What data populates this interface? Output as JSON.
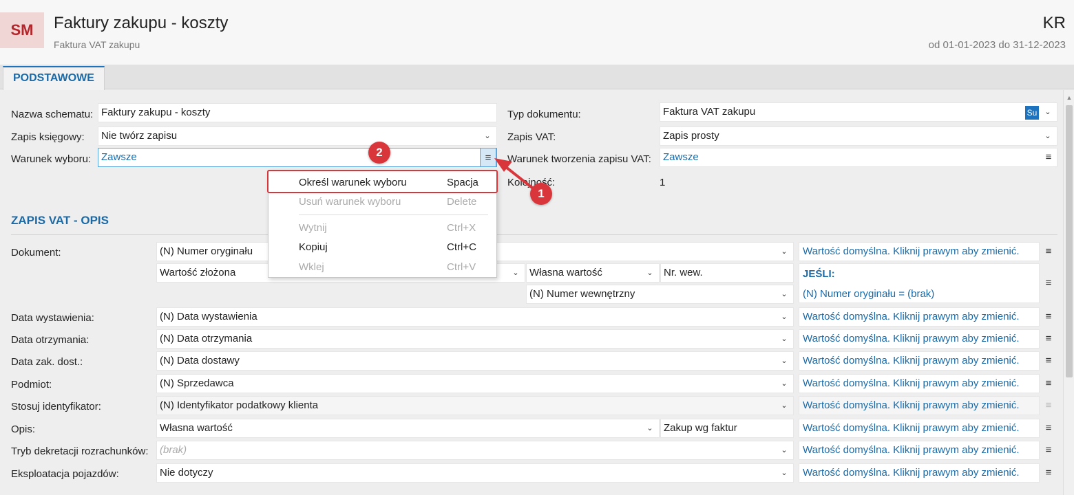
{
  "header": {
    "logo": "SM",
    "title": "Faktury zakupu - koszty",
    "subtitle": "Faktura VAT zakupu",
    "user_code": "KR",
    "period": "od 01-01-2023 do 31-12-2023"
  },
  "tabs": [
    {
      "label": "PODSTAWOWE",
      "active": true
    }
  ],
  "form": {
    "nazwa_label": "Nazwa schematu:",
    "nazwa_value": "Faktury zakupu - koszty",
    "zapis_ks_label": "Zapis księgowy:",
    "zapis_ks_value": "Nie twórz zapisu",
    "warunek_label": "Warunek wyboru:",
    "warunek_value": "Zawsze",
    "typ_dok_label": "Typ dokumentu:",
    "typ_dok_value": "Faktura VAT zakupu",
    "typ_dok_badge": "Su",
    "zapis_vat_label": "Zapis VAT:",
    "zapis_vat_value": "Zapis prosty",
    "warunek_vat_label": "Warunek tworzenia zapisu VAT:",
    "warunek_vat_value": "Zawsze",
    "kolejnosc_label": "Kolejność:",
    "kolejnosc_value": "1"
  },
  "section": {
    "title": "ZAPIS VAT - OPIS"
  },
  "rows": {
    "dokument": {
      "label": "Dokument:",
      "value": "(N) Numer oryginału",
      "rhs": "Wartość domyślna. Kliknij prawym aby zmienić."
    },
    "dokument_sub": {
      "value": "Wartość złożona",
      "own": "Własna wartość",
      "text": "Nr. wew.",
      "field": "(N) Numer wewnętrzny",
      "if_title": "JEŚLI:",
      "if_cond": "(N) Numer oryginału = (brak)"
    },
    "data_wyst": {
      "label": "Data wystawienia:",
      "value": "(N) Data wystawienia",
      "rhs": "Wartość domyślna. Kliknij prawym aby zmienić."
    },
    "data_otrz": {
      "label": "Data otrzymania:",
      "value": "(N) Data otrzymania",
      "rhs": "Wartość domyślna. Kliknij prawym aby zmienić."
    },
    "data_zak": {
      "label": "Data zak. dost.:",
      "value": "(N) Data dostawy",
      "rhs": "Wartość domyślna. Kliknij prawym aby zmienić."
    },
    "podmiot": {
      "label": "Podmiot:",
      "value": "(N) Sprzedawca",
      "rhs": "Wartość domyślna. Kliknij prawym aby zmienić."
    },
    "stosuj": {
      "label": "Stosuj identyfikator:",
      "value": "(N) Identyfikator podatkowy klienta",
      "rhs": "Wartość domyślna. Kliknij prawym aby zmienić."
    },
    "opis": {
      "label": "Opis:",
      "value": "Własna wartość",
      "text": "Zakup wg faktur",
      "rhs": "Wartość domyślna. Kliknij prawym aby zmienić."
    },
    "tryb": {
      "label": "Tryb dekretacji rozrachunków:",
      "placeholder": "(brak)",
      "rhs": "Wartość domyślna. Kliknij prawym aby zmienić."
    },
    "eksploatacja": {
      "label": "Eksploatacja pojazdów:",
      "value": "Nie dotyczy",
      "rhs": "Wartość domyślna. Kliknij prawym aby zmienić."
    }
  },
  "context_menu": {
    "items": [
      {
        "label": "Określ warunek wyboru",
        "shortcut": "Spacja",
        "enabled": true
      },
      {
        "label": "Usuń warunek wyboru",
        "shortcut": "Delete",
        "enabled": false
      },
      {
        "label": "Wytnij",
        "shortcut": "Ctrl+X",
        "enabled": false
      },
      {
        "label": "Kopiuj",
        "shortcut": "Ctrl+C",
        "enabled": true
      },
      {
        "label": "Wklej",
        "shortcut": "Ctrl+V",
        "enabled": false
      }
    ]
  },
  "annotations": {
    "badge1": "1",
    "badge2": "2"
  },
  "icons": {
    "menu": "≡",
    "chevron": "⌄"
  },
  "colors": {
    "accent": "#1e73be",
    "link": "#1a6aa8",
    "annotation": "#d9363b",
    "logo_bg": "#f1d6d6",
    "logo_fg": "#b3262b"
  }
}
